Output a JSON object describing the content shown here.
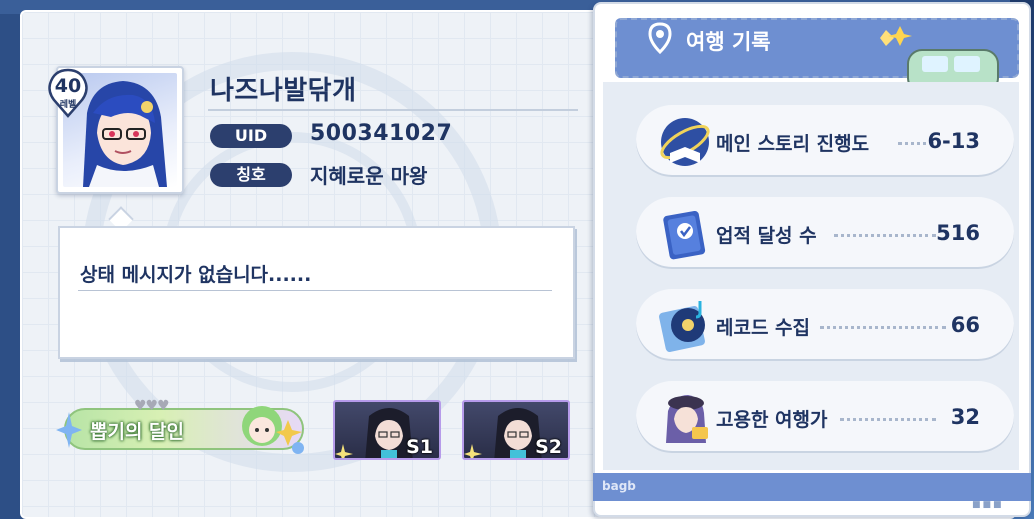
{
  "profile": {
    "level": "40",
    "level_label": "레벨",
    "nickname": "나즈나발닦개",
    "uid_label": "UID",
    "uid": "500341027",
    "title_label": "칭호",
    "title": "지혜로운 마왕",
    "status_message": "상태 메시지가 없습니다......"
  },
  "badges": {
    "main_label": "뽑기의 달인",
    "s1_label": "S1",
    "s2_label": "S2"
  },
  "travel_log": {
    "title": "여행 기록",
    "footer_brand": "bagb",
    "items": [
      {
        "label": "메인 스토리 진행도",
        "value": "6-13",
        "icon": "story-book-icon"
      },
      {
        "label": "업적 달성 수",
        "value": "516",
        "icon": "achievement-book-icon"
      },
      {
        "label": "레코드 수집",
        "value": "66",
        "icon": "record-disc-icon"
      },
      {
        "label": "고용한 여행가",
        "value": "32",
        "icon": "traveler-portrait-icon"
      }
    ]
  },
  "colors": {
    "navy": "#1f3462",
    "pill": "#2c3f6e",
    "panel_accent": "#6e8fd1",
    "background": "#2d4f86"
  }
}
